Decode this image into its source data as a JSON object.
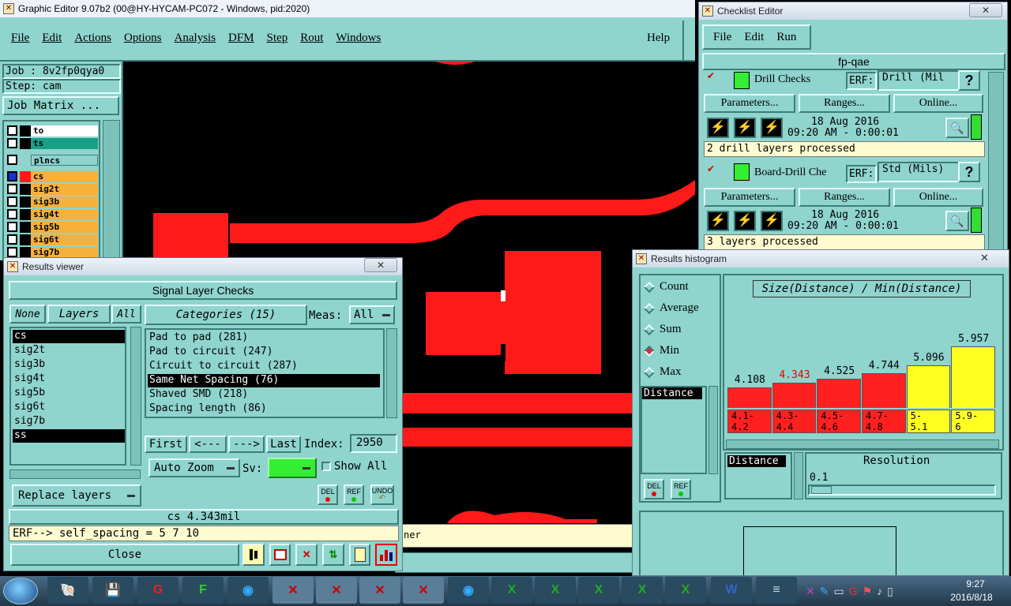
{
  "main_window": {
    "title": "Graphic Editor 9.07b2 (00@HY-HYCAM-PC072 - Windows, pid:2020)",
    "menu": [
      "File",
      "Edit",
      "Actions",
      "Options",
      "Analysis",
      "DFM",
      "Step",
      "Rout",
      "Windows"
    ],
    "help": "Help",
    "job": "Job : 8v2fp0qya0",
    "step": "Step: cam",
    "job_matrix": "Job Matrix ...",
    "layers": [
      {
        "name": "to",
        "color": "#ffffff"
      },
      {
        "name": "ts",
        "color": "#16a085"
      },
      {
        "name": "plncs",
        "color": "#8fd4cd"
      },
      {
        "name": "cs",
        "color": "#f5b13b"
      },
      {
        "name": "sig2t",
        "color": "#f5b13b"
      },
      {
        "name": "sig3b",
        "color": "#f5b13b"
      },
      {
        "name": "sig4t",
        "color": "#f5b13b"
      },
      {
        "name": "sig5b",
        "color": "#f5b13b"
      },
      {
        "name": "sig6t",
        "color": "#f5b13b"
      },
      {
        "name": "sig7b",
        "color": "#f5b13b"
      }
    ],
    "bottom_text": "ner"
  },
  "results_viewer": {
    "title": "Results viewer",
    "header": "Signal Layer Checks",
    "none_btn": "None",
    "layers_btn": "Layers",
    "all_btn": "All",
    "categories_btn": "Categories (15)",
    "meas_label": "Meas:",
    "meas_value": "All",
    "layer_list": [
      "cs",
      "sig2t",
      "sig3b",
      "sig4t",
      "sig5b",
      "sig6t",
      "sig7b",
      "ss"
    ],
    "categories": [
      "Pad to pad (281)",
      "Pad to circuit (247)",
      "Circuit to circuit (287)",
      "Same Net Spacing (76)",
      "Shaved SMD (218)",
      "Spacing length (86)"
    ],
    "nav": {
      "first": "First",
      "prev": "<---",
      "next": "--->",
      "last": "Last",
      "index_label": "Index:",
      "index_value": "2950"
    },
    "auto_zoom": "Auto Zoom",
    "sv_label": "Sv:",
    "show_all": "Show All",
    "replace_layers": "Replace layers",
    "del": "DEL",
    "ref": "REF",
    "undo": "UNDO",
    "status": "cs 4.343mil",
    "erf": "ERF--> self_spacing = 5 7 10",
    "close": "Close"
  },
  "checklist": {
    "title": "Checklist Editor",
    "menu": [
      "File",
      "Edit",
      "Run"
    ],
    "name": "fp-qae",
    "checks": [
      {
        "name": "Drill Checks",
        "erf_label": "ERF:",
        "erf_value": "Drill (Mil",
        "date": "18 Aug 2016",
        "time": "09:20 AM - 0:00:01",
        "status": "2 drill layers processed"
      },
      {
        "name": "Board-Drill Che",
        "erf_label": "ERF:",
        "erf_value": "Std (Mils)",
        "date": "18 Aug 2016",
        "time": "09:20 AM - 0:00:01",
        "status": "3 layers processed"
      }
    ],
    "buttons": [
      "Parameters...",
      "Ranges...",
      "Online..."
    ],
    "help_q": "?"
  },
  "histogram": {
    "title": "Results histogram",
    "modes": [
      "Count",
      "Average",
      "Sum",
      "Min",
      "Max"
    ],
    "selected_mode": "Min",
    "title_label": "Size(Distance) / Min(Distance)",
    "distance": "Distance",
    "distance2": "Distance",
    "resolution_label": "Resolution",
    "resolution_value": "0.1",
    "del": "DEL",
    "ref": "REF"
  },
  "chart_data": {
    "type": "bar",
    "title": "Size(Distance) / Min(Distance)",
    "categories": [
      "4.1-4.2",
      "4.3-4.4",
      "4.5-4.6",
      "4.7-4.8",
      "5-5.1",
      "5.9-6"
    ],
    "category_lines": [
      [
        "4.1-",
        "4.2"
      ],
      [
        "4.3-",
        "4.4"
      ],
      [
        "4.5-",
        "4.6"
      ],
      [
        "4.7-",
        "4.8"
      ],
      [
        "5-",
        "5.1"
      ],
      [
        "5.9-",
        "6"
      ]
    ],
    "values": [
      4.108,
      4.343,
      4.525,
      4.744,
      5.096,
      5.957
    ],
    "value_labels": [
      "4.108",
      "4.343",
      "4.525",
      "4.744",
      "5.096",
      "5.957"
    ],
    "colors": [
      "#ff2020",
      "#ff2020",
      "#ff2020",
      "#ff2020",
      "#ffff20",
      "#ffff20"
    ],
    "highlight_index": 1
  },
  "taskbar": {
    "time": "9:27",
    "date": "2016/8/18"
  }
}
